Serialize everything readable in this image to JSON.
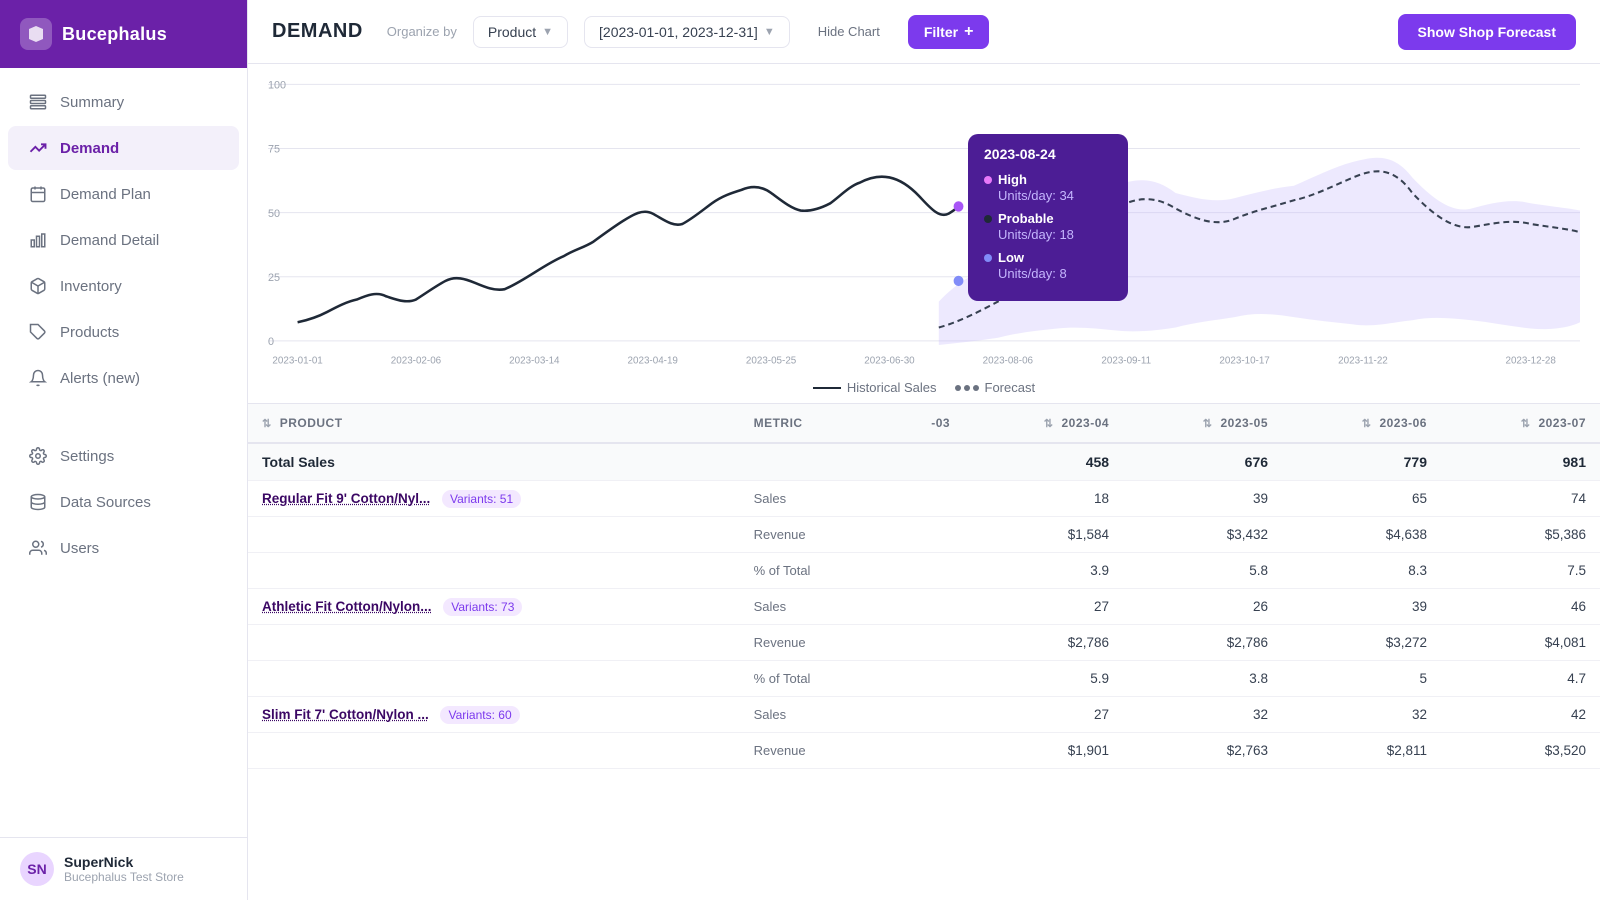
{
  "app": {
    "name": "Bucephalus"
  },
  "sidebar": {
    "items": [
      {
        "id": "summary",
        "label": "Summary",
        "icon": "layers"
      },
      {
        "id": "demand",
        "label": "Demand",
        "icon": "trending-up",
        "active": true
      },
      {
        "id": "demand-plan",
        "label": "Demand Plan",
        "icon": "calendar"
      },
      {
        "id": "demand-detail",
        "label": "Demand Detail",
        "icon": "bar-chart"
      },
      {
        "id": "inventory",
        "label": "Inventory",
        "icon": "box"
      },
      {
        "id": "products",
        "label": "Products",
        "icon": "tag"
      },
      {
        "id": "alerts",
        "label": "Alerts (new)",
        "icon": "bell"
      }
    ],
    "bottom_items": [
      {
        "id": "settings",
        "label": "Settings",
        "icon": "gear"
      },
      {
        "id": "data-sources",
        "label": "Data Sources",
        "icon": "database"
      },
      {
        "id": "users",
        "label": "Users",
        "icon": "users"
      }
    ],
    "user": {
      "name": "SuperNick",
      "store": "Bucephalus Test Store",
      "initials": "SN"
    }
  },
  "topbar": {
    "title": "DEMAND",
    "organize_label": "Organize by",
    "organize_value": "Product",
    "date_range": "[2023-01-01, 2023-12-31]",
    "hide_chart": "Hide Chart",
    "filter_label": "Filter",
    "show_forecast": "Show Shop Forecast"
  },
  "tooltip": {
    "date": "2023-08-24",
    "high_label": "High",
    "high_dot_color": "#e879f9",
    "high_units_label": "Units/day:",
    "high_units_value": "34",
    "probable_label": "Probable",
    "probable_dot_color": "#1f2937",
    "probable_units_label": "Units/day:",
    "probable_units_value": "18",
    "low_label": "Low",
    "low_dot_color": "#818cf8",
    "low_units_label": "Units/day:",
    "low_units_value": "8"
  },
  "chart": {
    "y_labels": [
      "100",
      "75",
      "50",
      "25",
      "0"
    ],
    "x_labels": [
      "2023-01-01",
      "2023-02-06",
      "2023-03-14",
      "2023-04-19",
      "2023-05-25",
      "2023-06-30",
      "2023-08-06",
      "2023-09-11",
      "2023-10-17",
      "2023-11-22",
      "2023-12-28"
    ],
    "legend_historical": "Historical Sales",
    "legend_forecast": "Forecast"
  },
  "table": {
    "columns": [
      {
        "id": "product",
        "label": "PRODUCT"
      },
      {
        "id": "metric",
        "label": "METRIC"
      },
      {
        "id": "col_03",
        "label": "-03"
      },
      {
        "id": "col_2023_04",
        "label": "2023-04",
        "sortable": true
      },
      {
        "id": "col_2023_05",
        "label": "2023-05",
        "sortable": true
      },
      {
        "id": "col_2023_06",
        "label": "2023-06",
        "sortable": true
      },
      {
        "id": "col_2023_07",
        "label": "2023-07",
        "sortable": true
      }
    ],
    "total_row": {
      "label": "Total Sales",
      "col_03": "",
      "col_04": "458",
      "col_05": "676",
      "col_06": "779",
      "col_07": "981"
    },
    "products": [
      {
        "name": "Regular Fit 9' Cotton/Nyl...",
        "variants": "Variants: 51",
        "rows": [
          {
            "metric": "Sales",
            "col_03": "",
            "col_04": "18",
            "col_05": "39",
            "col_06": "65",
            "col_07": "74"
          },
          {
            "metric": "Revenue",
            "col_03": "",
            "col_04": "$1,584",
            "col_05": "$3,432",
            "col_06": "$4,638",
            "col_07": "$5,386"
          },
          {
            "metric": "% of Total",
            "col_03": "",
            "col_04": "3.9",
            "col_05": "5.8",
            "col_06": "8.3",
            "col_07": "7.5"
          }
        ]
      },
      {
        "name": "Athletic Fit Cotton/Nylon...",
        "variants": "Variants: 73",
        "rows": [
          {
            "metric": "Sales",
            "col_03": "",
            "col_04": "27",
            "col_05": "26",
            "col_06": "39",
            "col_07": "46"
          },
          {
            "metric": "Revenue",
            "col_03": "",
            "col_04": "$2,786",
            "col_05": "$2,786",
            "col_06": "$3,272",
            "col_07": "$4,081"
          },
          {
            "metric": "% of Total",
            "col_03": "",
            "col_04": "5.9",
            "col_05": "3.8",
            "col_06": "5",
            "col_07": "4.7"
          }
        ]
      },
      {
        "name": "Slim Fit 7' Cotton/Nylon ...",
        "variants": "Variants: 60",
        "rows": [
          {
            "metric": "Sales",
            "col_03": "",
            "col_04": "27",
            "col_05": "32",
            "col_06": "32",
            "col_07": "42"
          },
          {
            "metric": "Revenue",
            "col_03": "",
            "col_04": "$1,901",
            "col_05": "$2,763",
            "col_06": "$2,811",
            "col_07": "$3,520"
          }
        ]
      }
    ]
  }
}
